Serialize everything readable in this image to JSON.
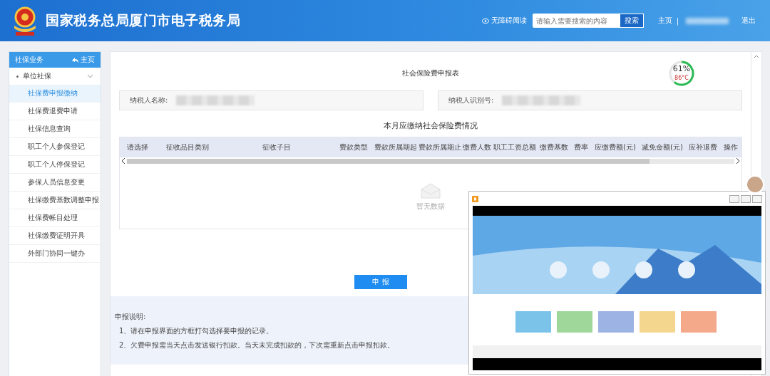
{
  "header": {
    "title": "国家税务总局厦门市电子税务局",
    "accessibility_link": "无障碍阅读",
    "search": {
      "placeholder": "请输入需要搜索的内容",
      "button": "搜索"
    },
    "home_link": "主页",
    "separator": "|",
    "logout": "退出"
  },
  "sidebar": {
    "title": "社保业务",
    "home_link": "主页",
    "group": {
      "label": "单位社保",
      "expanded": true,
      "children": [
        {
          "label": "社保费申报缴纳",
          "selected": true
        },
        {
          "label": "社保费退费申请",
          "selected": false
        },
        {
          "label": "社保信息查询",
          "selected": false
        },
        {
          "label": "职工个人参保登记",
          "selected": false
        },
        {
          "label": "职工个人停保登记",
          "selected": false
        },
        {
          "label": "参保人员信息变更",
          "selected": false
        },
        {
          "label": "社保缴费基数调整申报",
          "selected": false
        },
        {
          "label": "社保费帐目处理",
          "selected": false
        },
        {
          "label": "社保缴费证明开具",
          "selected": false
        },
        {
          "label": "外部门协同一键办",
          "selected": false
        }
      ]
    }
  },
  "gauge": {
    "reading": "61%",
    "temperature": "86°C"
  },
  "form": {
    "title": "社会保险费申报表",
    "fields": [
      {
        "label": "纳税人名称:"
      },
      {
        "label": "纳税人识别号:"
      }
    ]
  },
  "table": {
    "title": "本月应缴纳社会保险费情况",
    "columns": [
      "请选择",
      "征收品目类别",
      "征收子目",
      "费款类型",
      "费款所属期起",
      "费款所属期止",
      "缴费人数",
      "职工工资总额",
      "缴费基数",
      "费率",
      "应缴费额(元)",
      "减免金额(元)",
      "应补退费",
      "操作"
    ],
    "empty_text": "暂无数据"
  },
  "submit_button": "申 报",
  "notes": {
    "title": "申报说明:",
    "items": [
      "1、请在申报界面的方框打勾选择要申报的记录。",
      "2、欠费申报需当天点击发送银行扣款。当天未完成扣款的，下次需重新点击申报扣款。"
    ]
  }
}
